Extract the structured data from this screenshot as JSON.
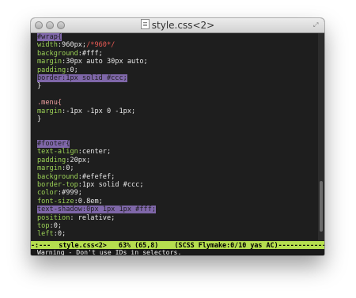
{
  "window": {
    "title": "style.css<2>"
  },
  "code_lines": [
    {
      "segments": [
        {
          "t": "#wrap",
          "c": "hl"
        },
        {
          "t": "{",
          "c": "hl"
        }
      ]
    },
    {
      "segments": [
        {
          "t": "width",
          "c": "prop"
        },
        {
          "t": ":960px;",
          "c": "val"
        },
        {
          "t": "/*960*/",
          "c": "comment"
        }
      ]
    },
    {
      "segments": [
        {
          "t": "background",
          "c": "prop"
        },
        {
          "t": ":#fff;",
          "c": "val"
        }
      ]
    },
    {
      "segments": [
        {
          "t": "margin",
          "c": "prop"
        },
        {
          "t": ":30px auto 30px auto;",
          "c": "val"
        }
      ]
    },
    {
      "segments": [
        {
          "t": "padding",
          "c": "prop"
        },
        {
          "t": ":0;",
          "c": "val"
        }
      ]
    },
    {
      "segments": [
        {
          "t": "border",
          "c": "hl"
        },
        {
          "t": ":1px solid #ccc;",
          "c": "hl"
        }
      ]
    },
    {
      "segments": [
        {
          "t": "}",
          "c": "punct"
        }
      ]
    },
    {
      "segments": []
    },
    {
      "segments": [
        {
          "t": ".menu{",
          "c": "selector"
        }
      ]
    },
    {
      "segments": [
        {
          "t": "margin",
          "c": "prop"
        },
        {
          "t": ":-1px -1px 0 -1px;",
          "c": "val"
        }
      ]
    },
    {
      "segments": [
        {
          "t": "}",
          "c": "punct"
        }
      ]
    },
    {
      "segments": []
    },
    {
      "segments": []
    },
    {
      "segments": [
        {
          "t": "#footer",
          "c": "hl"
        },
        {
          "t": "{",
          "c": "hl"
        }
      ]
    },
    {
      "segments": [
        {
          "t": "text-align",
          "c": "prop"
        },
        {
          "t": ":center;",
          "c": "val"
        }
      ]
    },
    {
      "segments": [
        {
          "t": "padding",
          "c": "prop"
        },
        {
          "t": ":20px;",
          "c": "val"
        }
      ]
    },
    {
      "segments": [
        {
          "t": "margin",
          "c": "prop"
        },
        {
          "t": ":0;",
          "c": "val"
        }
      ]
    },
    {
      "segments": [
        {
          "t": "background",
          "c": "prop"
        },
        {
          "t": ":#efefef;",
          "c": "val"
        }
      ]
    },
    {
      "segments": [
        {
          "t": "border-top",
          "c": "prop"
        },
        {
          "t": ":1px solid #ccc;",
          "c": "val"
        }
      ]
    },
    {
      "segments": [
        {
          "t": "color",
          "c": "prop"
        },
        {
          "t": ":#999;",
          "c": "val"
        }
      ]
    },
    {
      "segments": [
        {
          "t": "font-size",
          "c": "prop"
        },
        {
          "t": ":0.8em;",
          "c": "val"
        }
      ]
    },
    {
      "segments": [
        {
          "t": "text-shadow",
          "c": "hl"
        },
        {
          "t": ":0px 1px 1px #fff;",
          "c": "hl"
        }
      ]
    },
    {
      "segments": [
        {
          "t": "position",
          "c": "prop"
        },
        {
          "t": ": relative;",
          "c": "val"
        }
      ]
    },
    {
      "segments": [
        {
          "t": "top",
          "c": "prop"
        },
        {
          "t": ":0;",
          "c": "val"
        }
      ]
    },
    {
      "segments": [
        {
          "t": "left",
          "c": "prop"
        },
        {
          "t": ":0;",
          "c": "val"
        }
      ]
    }
  ],
  "status": {
    "modeline": "-:---  style.css<2>   63% (65,8)    (SCSS Flymake:0/10 yas AC)----------------",
    "message": "Warning - Don't use IDs in selectors."
  },
  "colors": {
    "highlight": "#7f67a9",
    "property": "#9bd156",
    "comment": "#e95a54",
    "modeline_bg": "#b5de4f",
    "editor_bg": "#1e1e1e"
  },
  "icons": {
    "traffic_lights": [
      "close-icon",
      "minimize-icon",
      "zoom-icon"
    ],
    "title_icon": "document-icon",
    "resize": "fullscreen-icon"
  }
}
